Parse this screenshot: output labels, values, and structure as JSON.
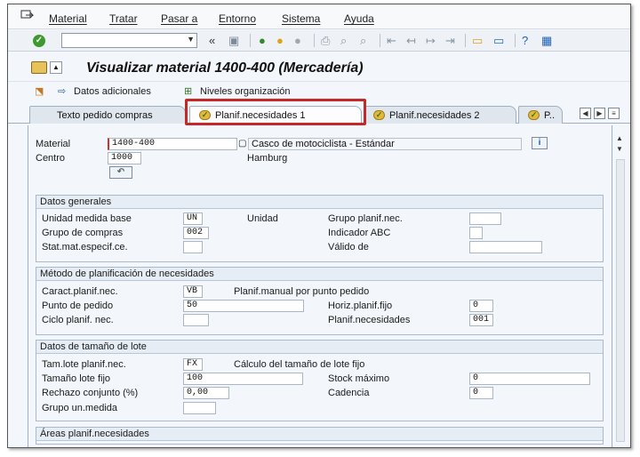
{
  "menu": [
    "Material",
    "Tratar",
    "Pasar a",
    "Entorno",
    "Sistema",
    "Ayuda"
  ],
  "title": "Visualizar material 1400-400 (Mercadería)",
  "app_toolbar": {
    "datos_adicionales": "Datos adicionales",
    "niveles_organizacion": "Niveles organización"
  },
  "tabs": [
    "Texto pedido compras",
    "Planif.necesidades 1",
    "Planif.necesidades 2",
    "P.."
  ],
  "header": {
    "material_label": "Material",
    "material_value": "1400-400",
    "material_desc": "Casco de motociclista - Estándar",
    "centro_label": "Centro",
    "centro_value": "1000",
    "centro_desc": "Hamburg"
  },
  "datos_generales": {
    "title": "Datos generales",
    "unidad_medida_label": "Unidad medida base",
    "unidad_medida_value": "UN",
    "unidad_text": "Unidad",
    "grupo_planif_label": "Grupo planif.nec.",
    "grupo_planif_value": "",
    "grupo_compras_label": "Grupo de compras",
    "grupo_compras_value": "002",
    "indicador_abc_label": "Indicador ABC",
    "indicador_abc_value": "",
    "stat_mat_label": "Stat.mat.especif.ce.",
    "stat_mat_value": "",
    "valido_de_label": "Válido de",
    "valido_de_value": ""
  },
  "metodo_planif": {
    "title": "Método de planificación de necesidades",
    "caract_label": "Caract.planif.nec.",
    "caract_value": "VB",
    "caract_desc": "Planif.manual por punto pedido",
    "punto_pedido_label": "Punto de pedido",
    "punto_pedido_value": "50",
    "horiz_label": "Horiz.planif.fijo",
    "horiz_value": "0",
    "ciclo_label": "Ciclo planif. nec.",
    "ciclo_value": "",
    "planif_nec_label": "Planif.necesidades",
    "planif_nec_value": "001"
  },
  "datos_lote": {
    "title": "Datos de tamaño de lote",
    "tam_lote_label": "Tam.lote planif.nec.",
    "tam_lote_value": "FX",
    "tam_lote_desc": "Cálculo del tamaño de lote fijo",
    "tam_fijo_label": "Tamaño lote fijo",
    "tam_fijo_value": "100",
    "stock_max_label": "Stock máximo",
    "stock_max_value": "0",
    "rechazo_label": "Rechazo conjunto (%)",
    "rechazo_value": "0,00",
    "cadencia_label": "Cadencia",
    "cadencia_value": "0",
    "grupo_um_label": "Grupo un.medida",
    "grupo_um_value": ""
  },
  "areas": {
    "title": "Áreas planif.necesidades"
  },
  "colors": {
    "highlight": "#c62828",
    "ok_green": "#3d9a2e",
    "tab_check_gold": "#e4b83a"
  }
}
